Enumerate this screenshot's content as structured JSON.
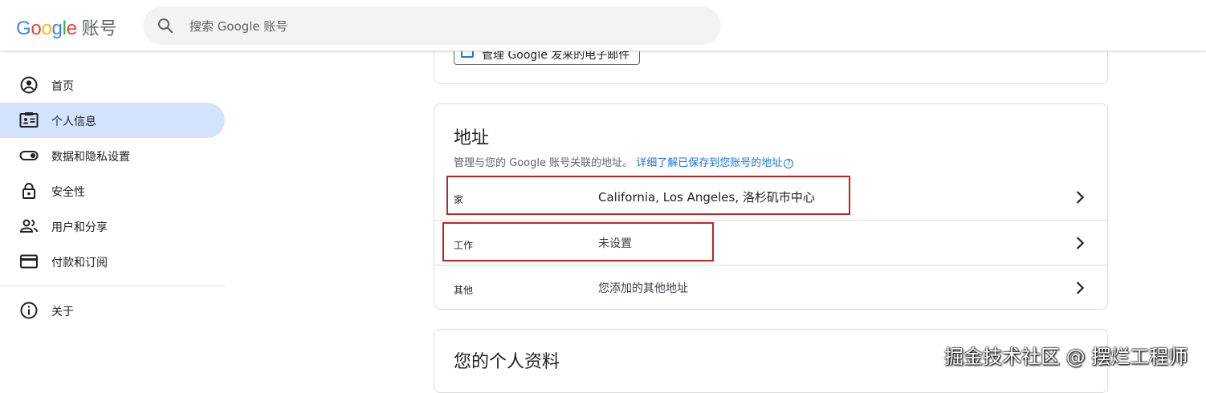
{
  "header": {
    "logo_word": "Google",
    "logo_colors": [
      "#4285F4",
      "#EA4335",
      "#FBBC05",
      "#4285F4",
      "#34A853",
      "#EA4335"
    ],
    "title": "账号",
    "search_placeholder": "搜索 Google 账号"
  },
  "sidebar": {
    "items": [
      {
        "label": "首页",
        "icon": "account-circle-icon"
      },
      {
        "label": "个人信息",
        "icon": "id-card-icon",
        "active": true
      },
      {
        "label": "数据和隐私设置",
        "icon": "toggle-icon"
      },
      {
        "label": "安全性",
        "icon": "lock-icon"
      },
      {
        "label": "用户和分享",
        "icon": "people-icon"
      },
      {
        "label": "付款和订阅",
        "icon": "credit-card-icon"
      }
    ],
    "about": {
      "label": "关于",
      "icon": "info-icon"
    }
  },
  "top_card": {
    "manage_email_label": "管理 Google 发来的电子邮件"
  },
  "address_card": {
    "title": "地址",
    "description": "管理与您的 Google 账号关联的地址。",
    "learn_more": "详细了解已保存到您账号的地址",
    "rows": [
      {
        "label": "家",
        "value": "California, Los Angeles, 洛杉矶市中心"
      },
      {
        "label": "工作",
        "value": "未设置"
      },
      {
        "label": "其他",
        "value": "您添加的其他地址"
      }
    ]
  },
  "profile_card": {
    "title": "您的个人资料"
  },
  "watermark": "掘金技术社区 @ 摆烂工程师",
  "colors": {
    "active_nav": "#d3e3fd",
    "link": "#1a73e8",
    "highlight_box": "#c5221f"
  }
}
